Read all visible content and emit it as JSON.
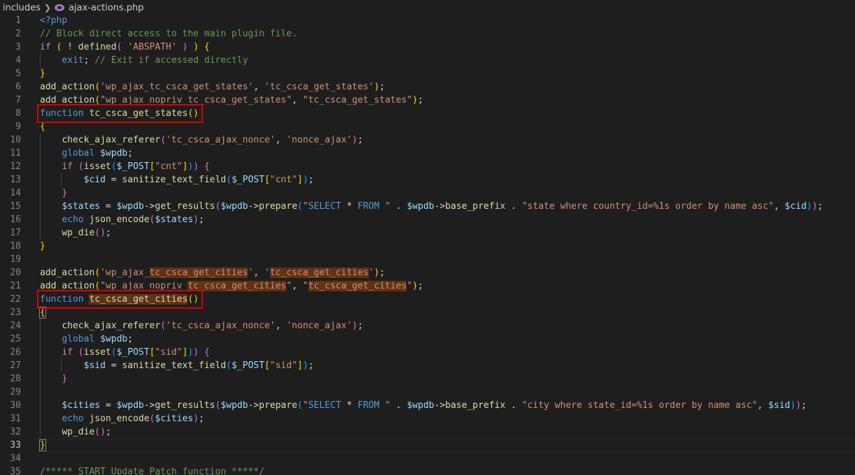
{
  "breadcrumb": {
    "folder": "includes",
    "file": "ajax-actions.php",
    "file_icon": "php-elephant-icon"
  },
  "editor": {
    "current_line": 33,
    "highlight_box_color": "#e00000",
    "lines": [
      {
        "n": "1",
        "text": "<?php"
      },
      {
        "n": "2",
        "text": "// Block direct access to the main plugin file."
      },
      {
        "n": "3",
        "text": "if ( ! defined( 'ABSPATH' ) ) {"
      },
      {
        "n": "4",
        "text": "    exit; // Exit if accessed directly"
      },
      {
        "n": "5",
        "text": "}"
      },
      {
        "n": "6",
        "text": "add_action('wp_ajax_tc_csca_get_states', 'tc_csca_get_states');"
      },
      {
        "n": "7",
        "text": "add_action(\"wp_ajax_nopriv_tc_csca_get_states\", \"tc_csca_get_states\");"
      },
      {
        "n": "8",
        "text": "function tc_csca_get_states()"
      },
      {
        "n": "9",
        "text": "{"
      },
      {
        "n": "10",
        "text": "    check_ajax_referer('tc_csca_ajax_nonce', 'nonce_ajax');"
      },
      {
        "n": "11",
        "text": "    global $wpdb;"
      },
      {
        "n": "12",
        "text": "    if (isset($_POST[\"cnt\"])) {"
      },
      {
        "n": "13",
        "text": "        $cid = sanitize_text_field($_POST[\"cnt\"]);"
      },
      {
        "n": "14",
        "text": "    }"
      },
      {
        "n": "15",
        "text": "    $states = $wpdb->get_results($wpdb->prepare(\"SELECT * FROM \" . $wpdb->base_prefix . \"state where country_id=%1s order by name asc\", $cid));"
      },
      {
        "n": "16",
        "text": "    echo json_encode($states);"
      },
      {
        "n": "17",
        "text": "    wp_die();"
      },
      {
        "n": "18",
        "text": "}"
      },
      {
        "n": "19",
        "text": ""
      },
      {
        "n": "20",
        "text": "add_action('wp_ajax_tc_csca_get_cities', 'tc_csca_get_cities');"
      },
      {
        "n": "21",
        "text": "add_action(\"wp_ajax_nopriv_tc_csca_get_cities\", \"tc_csca_get_cities\");"
      },
      {
        "n": "22",
        "text": "function tc_csca_get_cities()"
      },
      {
        "n": "23",
        "text": "{"
      },
      {
        "n": "24",
        "text": "    check_ajax_referer('tc_csca_ajax_nonce', 'nonce_ajax');"
      },
      {
        "n": "25",
        "text": "    global $wpdb;"
      },
      {
        "n": "26",
        "text": "    if (isset($_POST[\"sid\"])) {"
      },
      {
        "n": "27",
        "text": "        $sid = sanitize_text_field($_POST[\"sid\"]);"
      },
      {
        "n": "28",
        "text": "    }"
      },
      {
        "n": "29",
        "text": ""
      },
      {
        "n": "30",
        "text": "    $cities = $wpdb->get_results($wpdb->prepare(\"SELECT * FROM \" . $wpdb->base_prefix . \"city where state_id=%1s order by name asc\", $sid));"
      },
      {
        "n": "31",
        "text": "    echo json_encode($cities);"
      },
      {
        "n": "32",
        "text": "    wp_die();"
      },
      {
        "n": "33",
        "text": "}"
      },
      {
        "n": "34",
        "text": ""
      },
      {
        "n": "35",
        "text": "/***** START Update Patch function *****/"
      }
    ]
  }
}
